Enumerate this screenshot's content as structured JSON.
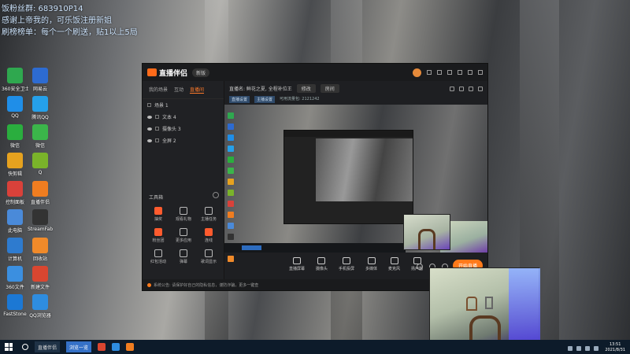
{
  "overlay": {
    "line1": "饭粉丝群: 683910P14",
    "line2": "感谢上帝我的，可乐饭注册新姐",
    "line3": "刷榜榜单：每个一个刷送，贴1以上5局"
  },
  "desktop": {
    "icons": [
      {
        "label": "360安全卫士",
        "color": "#2fa84f"
      },
      {
        "label": "网易云",
        "color": "#2d6bd1"
      },
      {
        "label": "QQ",
        "color": "#1f8ee8"
      },
      {
        "label": "腾讯QQ",
        "color": "#25a0ea"
      },
      {
        "label": "微信",
        "color": "#2aae3e"
      },
      {
        "label": "微信",
        "color": "#3bb54a"
      },
      {
        "label": "快剪辑",
        "color": "#e6a21f"
      },
      {
        "label": "Q",
        "color": "#7ab32a"
      },
      {
        "label": "控制面板",
        "color": "#d9413a"
      },
      {
        "label": "直播伴侣",
        "color": "#f07d20"
      },
      {
        "label": "此电脑",
        "color": "#4a8ad9"
      },
      {
        "label": "StreamFab",
        "color": "#333333"
      },
      {
        "label": "计算机",
        "color": "#2e7bcf"
      },
      {
        "label": "回收站",
        "color": "#f08a2a"
      },
      {
        "label": "360文件",
        "color": "#3b8fe0"
      },
      {
        "label": "新建文件",
        "color": "#d94630"
      },
      {
        "label": "FastStone",
        "color": "#1c78d4"
      },
      {
        "label": "QQ浏览器",
        "color": "#2e8de0"
      }
    ]
  },
  "app": {
    "logo": "直播伴侣",
    "version": "新版",
    "tabs": [
      "我的场景",
      "互动",
      "直播间"
    ],
    "active_tab": "直播间",
    "scene_header": "场景 1",
    "scenes": [
      "文本 4",
      "摄像头 3",
      "全屏 2"
    ],
    "toolbox_title": "工具箱",
    "tools": [
      {
        "label": "抽奖",
        "hot": true
      },
      {
        "label": "观看礼物",
        "hot": false
      },
      {
        "label": "主播任务",
        "hot": false
      },
      {
        "label": "粉丝团",
        "hot": true
      },
      {
        "label": "更多应用",
        "hot": false
      },
      {
        "label": "连线",
        "hot": true
      },
      {
        "label": "红包活动",
        "hot": false
      },
      {
        "label": "弹幕",
        "hot": false
      },
      {
        "label": "歌词显示",
        "hot": false
      }
    ],
    "stream": {
      "title": "直播名: 鲜花之夏, 全程补位王",
      "edit_button": "修改",
      "room_button": "房间",
      "tag1": "直播设置",
      "tag2": "主播设置",
      "meta": "可用流量包: 2121242"
    },
    "bottom_tools": [
      "直播屏幕",
      "摄像头",
      "手机投屏",
      "多媒体",
      "麦克风",
      "扬声器"
    ],
    "go_live": "开始直播",
    "status_text": "系统公告: 请保护好自己的隐私信息，谨防诈骗，更多一键查"
  },
  "taskbar": {
    "app_label": "直播伴侣",
    "browser_label": "浏览一览",
    "time": "13:51",
    "date": "2021/8/31"
  }
}
